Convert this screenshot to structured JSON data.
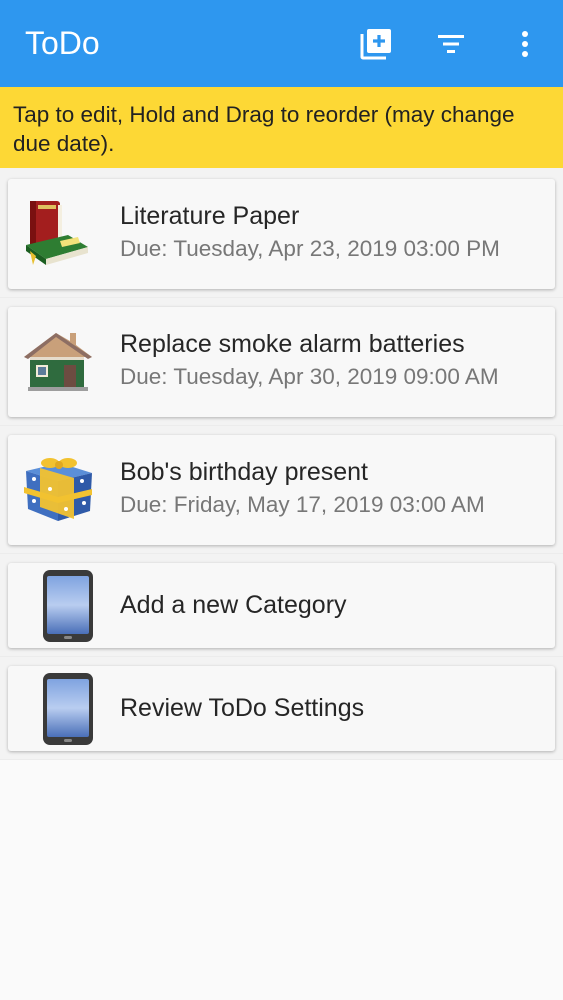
{
  "app_bar": {
    "title": "ToDo",
    "actions": [
      {
        "icon": "add-box-icon"
      },
      {
        "icon": "filter-list-icon"
      },
      {
        "icon": "more-vert-icon"
      }
    ],
    "color": "#2e97ef"
  },
  "banner": {
    "text": "Tap to edit, Hold and Drag to reorder (may change due date).",
    "color": "#fdd835"
  },
  "tasks": [
    {
      "title": "Literature Paper",
      "due": "Due: Tuesday, Apr 23, 2019 03:00 PM",
      "icon": "books-icon"
    },
    {
      "title": "Replace smoke alarm batteries",
      "due": "Due: Tuesday, Apr 30, 2019 09:00 AM",
      "icon": "house-icon"
    },
    {
      "title": "Bob's birthday present",
      "due": "Due: Friday, May 17, 2019 03:00 AM",
      "icon": "gift-icon"
    }
  ],
  "shortcuts": [
    {
      "title": "Add a new Category",
      "icon": "phone-icon"
    },
    {
      "title": "Review ToDo Settings",
      "icon": "phone-icon"
    }
  ]
}
